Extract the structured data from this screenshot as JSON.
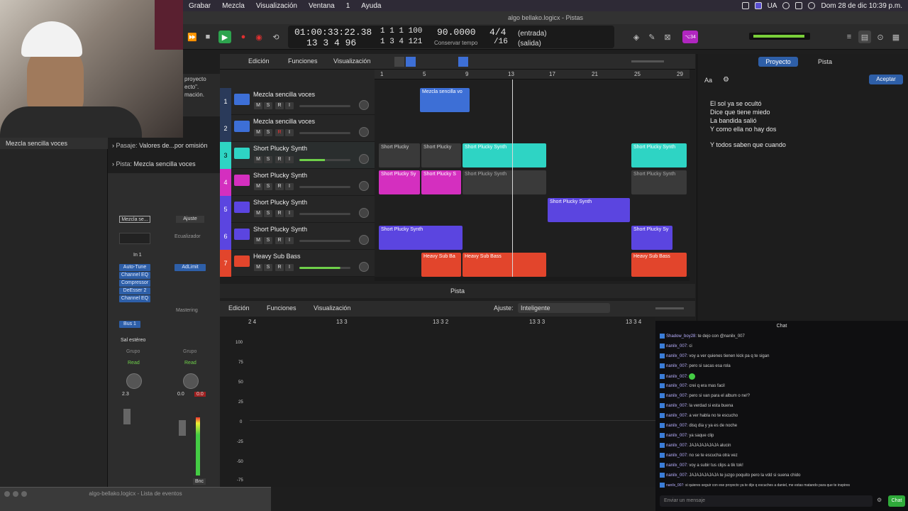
{
  "menubar": {
    "items": [
      "Grabar",
      "Mezcla",
      "Visualización",
      "Ventana",
      "1",
      "Ayuda"
    ],
    "window_title": "algo bellako.logicx - Pistas",
    "lang": "UA",
    "datetime": "Dom 28 de dic  10:39 p.m."
  },
  "transport": {
    "time": "01:00:33:22.38",
    "bars_top": "1  1  1  100",
    "bars_bottom": "13  3  4  96",
    "bars_bottom2": "1  3  4 121",
    "tempo": "90.0000",
    "tempo_sub": "Conservar tempo",
    "signature": "4/4",
    "division": "/16",
    "input": "(entrada)",
    "output": "(salida)",
    "badge": "⌥34"
  },
  "inspector": {
    "region_label": "Mezcla sencilla voces",
    "left_snippet": [
      "proyecto",
      "ecto\".",
      "mación."
    ],
    "passage_label": "Pasaje:",
    "passage_value": "Valores de...por omisión",
    "track_label": "Pista:",
    "track_value": "Mezcla sencilla voces"
  },
  "channel_strip": {
    "name_left": "Mezcla se...",
    "name_right": "Ajuste",
    "eq_label": "Ecualizador",
    "input": "In 1",
    "plugins": [
      "Auto-Tune",
      "Channel EQ",
      "Compressor",
      "DeEsser 2",
      "Channel EQ"
    ],
    "right_plugin": "AdLimit",
    "mastering": "Mastering",
    "bus": "Bus 1",
    "output": "Sal estéreo",
    "group_left": "Grupo",
    "group_right": "Grupo",
    "auto_left": "Read",
    "auto_right": "Read",
    "val_left": "2.3",
    "val_right_a": "0.0",
    "val_right_b": "0.0",
    "bnc": "Bnc"
  },
  "edit_bar": {
    "edicion": "Edición",
    "funciones": "Funciones",
    "visualizacion": "Visualización"
  },
  "tracks": [
    {
      "num": "1",
      "name": "Mezcla sencilla voces",
      "color": "#3d6fd6"
    },
    {
      "num": "2",
      "name": "Mezcla sencilla voces",
      "color": "#3d6fd6"
    },
    {
      "num": "3",
      "name": "Short Plucky Synth",
      "color": "#2ed4c4"
    },
    {
      "num": "4",
      "name": "Short Plucky Synth",
      "color": "#d42fbf"
    },
    {
      "num": "5",
      "name": "Short Plucky Synth",
      "color": "#5b45e0"
    },
    {
      "num": "6",
      "name": "Short Plucky Synth",
      "color": "#5b45e0"
    },
    {
      "num": "7",
      "name": "Heavy Sub Bass",
      "color": "#e2452c"
    }
  ],
  "ruler": [
    "1",
    "5",
    "9",
    "13",
    "17",
    "21",
    "25",
    "29"
  ],
  "regions": {
    "vocal": "Mezcla sencilla vo",
    "pluck": "Short Plucky",
    "pluck_synth": "Short Plucky Synth",
    "pluck_s": "Short Plucky S",
    "pluck_sy": "Short Plucky Sy",
    "bass_short": "Heavy Sub Ba",
    "bass": "Heavy Sub Bass"
  },
  "piano": {
    "title": "Pista",
    "edicion": "Edición",
    "funciones": "Funciones",
    "visualizacion": "Visualización",
    "ajuste_label": "Ajuste:",
    "ajuste_value": "Inteligente",
    "ruler": [
      "2 4",
      "13 3",
      "13 3 2",
      "13 3 3",
      "13 3 4"
    ],
    "yticks": [
      "100",
      "75",
      "50",
      "25",
      "0",
      "-25",
      "-50",
      "-75",
      "-100"
    ]
  },
  "notepad": {
    "tab_project": "Proyecto",
    "tab_track": "Pista",
    "accept": "Aceptar",
    "aa": "Aa",
    "lines": [
      "El sol ya se ocultó",
      "Dice que tiene miedo",
      "La bandida salió",
      "Y como ella no hay dos",
      "",
      " Y todos saben que cuando"
    ]
  },
  "chat": {
    "title": "Chat",
    "input_placeholder": "Enviar un mensaje",
    "send": "Chat",
    "messages": [
      {
        "user": "Shadow_boy28:",
        "text": "te dejo con @nanilx_007"
      },
      {
        "user": "nanilx_007:",
        "text": "ci"
      },
      {
        "user": "nanilx_007:",
        "text": "voy a ver quienes tienen kick pa q te sigan"
      },
      {
        "user": "nanilx_007:",
        "text": "pero si sacas esa rola"
      },
      {
        "user": "nanilx_007:",
        "text": ""
      },
      {
        "user": "nanilx_007:",
        "text": "crei q era mas facil"
      },
      {
        "user": "nanilx_007:",
        "text": "pero si van para el album o ne!?"
      },
      {
        "user": "nanilx_007:",
        "text": "la verdad si esta buena"
      },
      {
        "user": "nanilx_007:",
        "text": "a ver habla no te escucho"
      },
      {
        "user": "nanilx_007:",
        "text": "disq dia y ya es de noche"
      },
      {
        "user": "nanilx_007:",
        "text": "ya saque clip"
      },
      {
        "user": "nanilx_007:",
        "text": "JAJAJAJAJAJA alucin"
      },
      {
        "user": "nanilx_007:",
        "text": "no se te escucha otra vez"
      },
      {
        "user": "nanilx_007:",
        "text": "voy a subir tus clips a tik tok!"
      },
      {
        "user": "nanilx_007:",
        "text": "JAJAJAJAJAJA te juzgo poquito pero la vdd si suena chido"
      },
      {
        "user": "nanilx_007:",
        "text": "si quieres seguir con ese proyecto ya te dije q escuches a daniel, me estas matando para que te inspires"
      }
    ]
  },
  "bottom_window": "algo-bellako.logicx - Lista de eventos",
  "colors": {
    "accent": "#2e5fa8",
    "cyan": "#2ed4c4",
    "magenta": "#d42fbf",
    "purple": "#5b45e0",
    "red": "#e2452c",
    "blue": "#3d6fd6"
  }
}
